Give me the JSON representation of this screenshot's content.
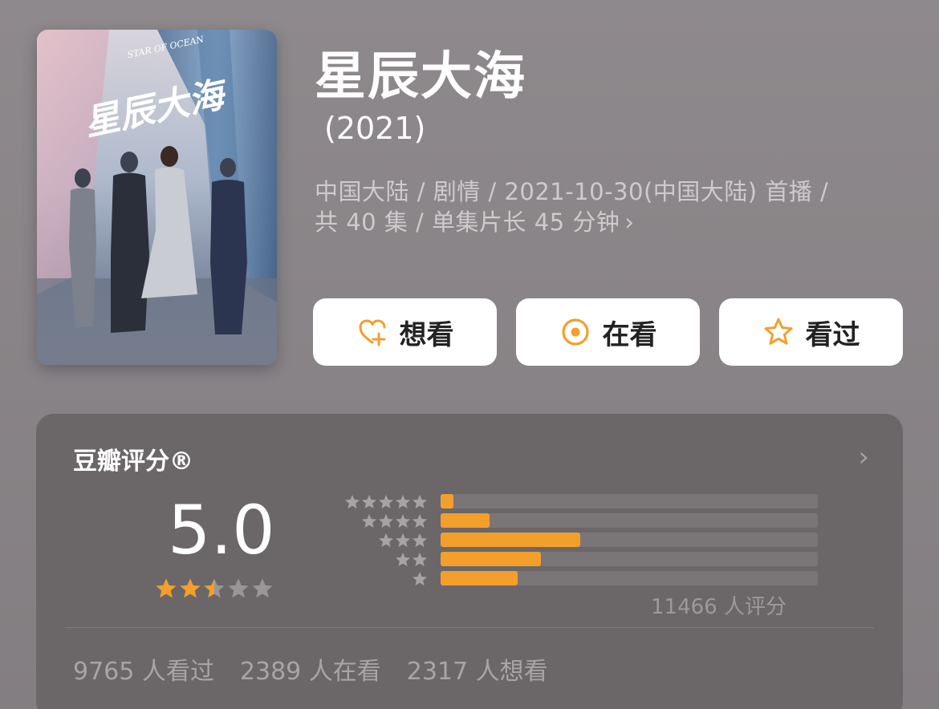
{
  "poster": {
    "title_art": "星辰大海",
    "subtitle_art": "STAR OF OCEAN"
  },
  "title": "星辰大海",
  "year": "(2021)",
  "meta": {
    "line1": "中国大陆 / 剧情 / 2021-10-30(中国大陆) 首播 /",
    "line2": "共 40 集 / 单集片长 45 分钟",
    "chevron": "›"
  },
  "actions": {
    "want": {
      "label": "想看",
      "icon": "heart-plus-icon"
    },
    "watching": {
      "label": "在看",
      "icon": "target-icon"
    },
    "watched": {
      "label": "看过",
      "icon": "star-outline-icon"
    }
  },
  "rating": {
    "title": "豆瓣评分®",
    "chevron": "›",
    "score": "5.0",
    "stars": 2.5,
    "distribution": [
      {
        "stars": 5,
        "fraction": 0.035
      },
      {
        "stars": 4,
        "fraction": 0.13
      },
      {
        "stars": 3,
        "fraction": 0.37
      },
      {
        "stars": 2,
        "fraction": 0.265
      },
      {
        "stars": 1,
        "fraction": 0.205
      }
    ],
    "raters": "11466 人评分"
  },
  "stats": {
    "watched": "9765 人看过",
    "watching": "2389 人在看",
    "want": "2317 人想看"
  },
  "colors": {
    "accent": "#f39f2c",
    "star_off": "#9a9698",
    "card": "#6b6769"
  }
}
